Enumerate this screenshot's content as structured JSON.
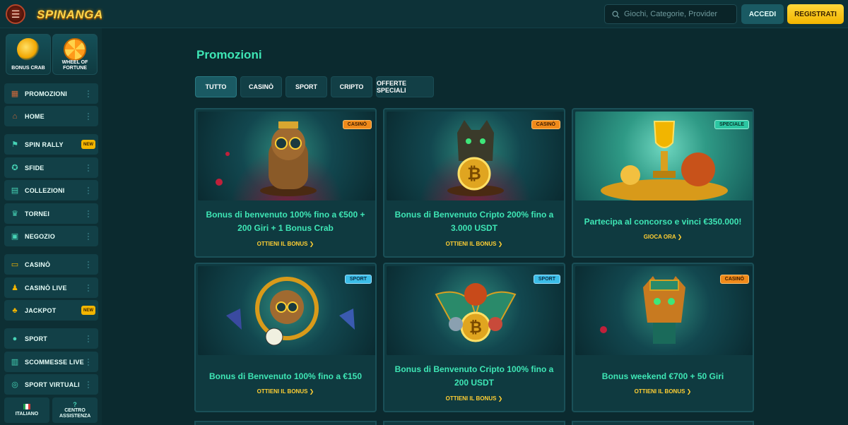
{
  "header": {
    "logo": "SPINANGA",
    "search_placeholder": "Giochi, Categorie, Provider",
    "login_label": "ACCEDI",
    "register_label": "REGISTRATI"
  },
  "sidebar": {
    "tiles": [
      {
        "label": "BONUS CRAB",
        "icon": "crab-claw-icon"
      },
      {
        "label": "WHEEL OF FORTUNE",
        "icon": "wheel-icon"
      }
    ],
    "items": [
      {
        "label": "PROMOZIONI",
        "icon": "gift-icon"
      },
      {
        "label": "HOME",
        "icon": "home-icon"
      },
      {
        "label": "SPIN RALLY",
        "icon": "flag-icon",
        "badge": "NEW"
      },
      {
        "label": "SFIDE",
        "icon": "medal-icon"
      },
      {
        "label": "COLLEZIONI",
        "icon": "cards-icon"
      },
      {
        "label": "TORNEI",
        "icon": "trophy-icon"
      },
      {
        "label": "NEGOZIO",
        "icon": "shop-icon"
      },
      {
        "label": "CASINÒ",
        "icon": "slot-icon"
      },
      {
        "label": "CASINÒ LIVE",
        "icon": "dealer-icon"
      },
      {
        "label": "JACKPOT",
        "icon": "clover-icon",
        "badge": "NEW"
      },
      {
        "label": "SPORT",
        "icon": "soccer-ball-icon"
      },
      {
        "label": "SCOMMESSE LIVE",
        "icon": "live-icon"
      },
      {
        "label": "SPORT VIRTUALI",
        "icon": "virtual-icon"
      }
    ],
    "language": "ITALIANO",
    "support": "CENTRO ASSISTENZA"
  },
  "main": {
    "title": "Promozioni",
    "tabs": [
      "TUTTO",
      "CASINÒ",
      "SPORT",
      "CRIPTO",
      "OFFERTE SPECIALI"
    ],
    "cards": [
      {
        "badge": "CASINÒ",
        "title": "Bonus di benvenuto 100% fino a €500 + 200 Giri + 1 Bonus Crab",
        "cta": "OTTIENI IL BONUS"
      },
      {
        "badge": "CASINÒ",
        "title": "Bonus di Benvenuto Cripto 200% fino a 3.000 USDT",
        "cta": "OTTIENI IL BONUS"
      },
      {
        "badge": "SPECIALE",
        "title": "Partecipa al concorso e vinci €350.000!",
        "cta": "GIOCA ORA"
      },
      {
        "badge": "SPORT",
        "title": "Bonus di Benvenuto 100% fino a €150",
        "cta": "OTTIENI IL BONUS"
      },
      {
        "badge": "SPORT",
        "title": "Bonus di Benvenuto Cripto 100% fino a 200 USDT",
        "cta": "OTTIENI IL BONUS"
      },
      {
        "badge": "CASINÒ",
        "title": "Bonus weekend €700 + 50 Giri",
        "cta": "OTTIENI IL BONUS"
      }
    ]
  },
  "colors": {
    "accent": "#3ee6b5",
    "cta": "#ffcf33",
    "register": "#f2b500",
    "background": "#0b2a2f"
  }
}
